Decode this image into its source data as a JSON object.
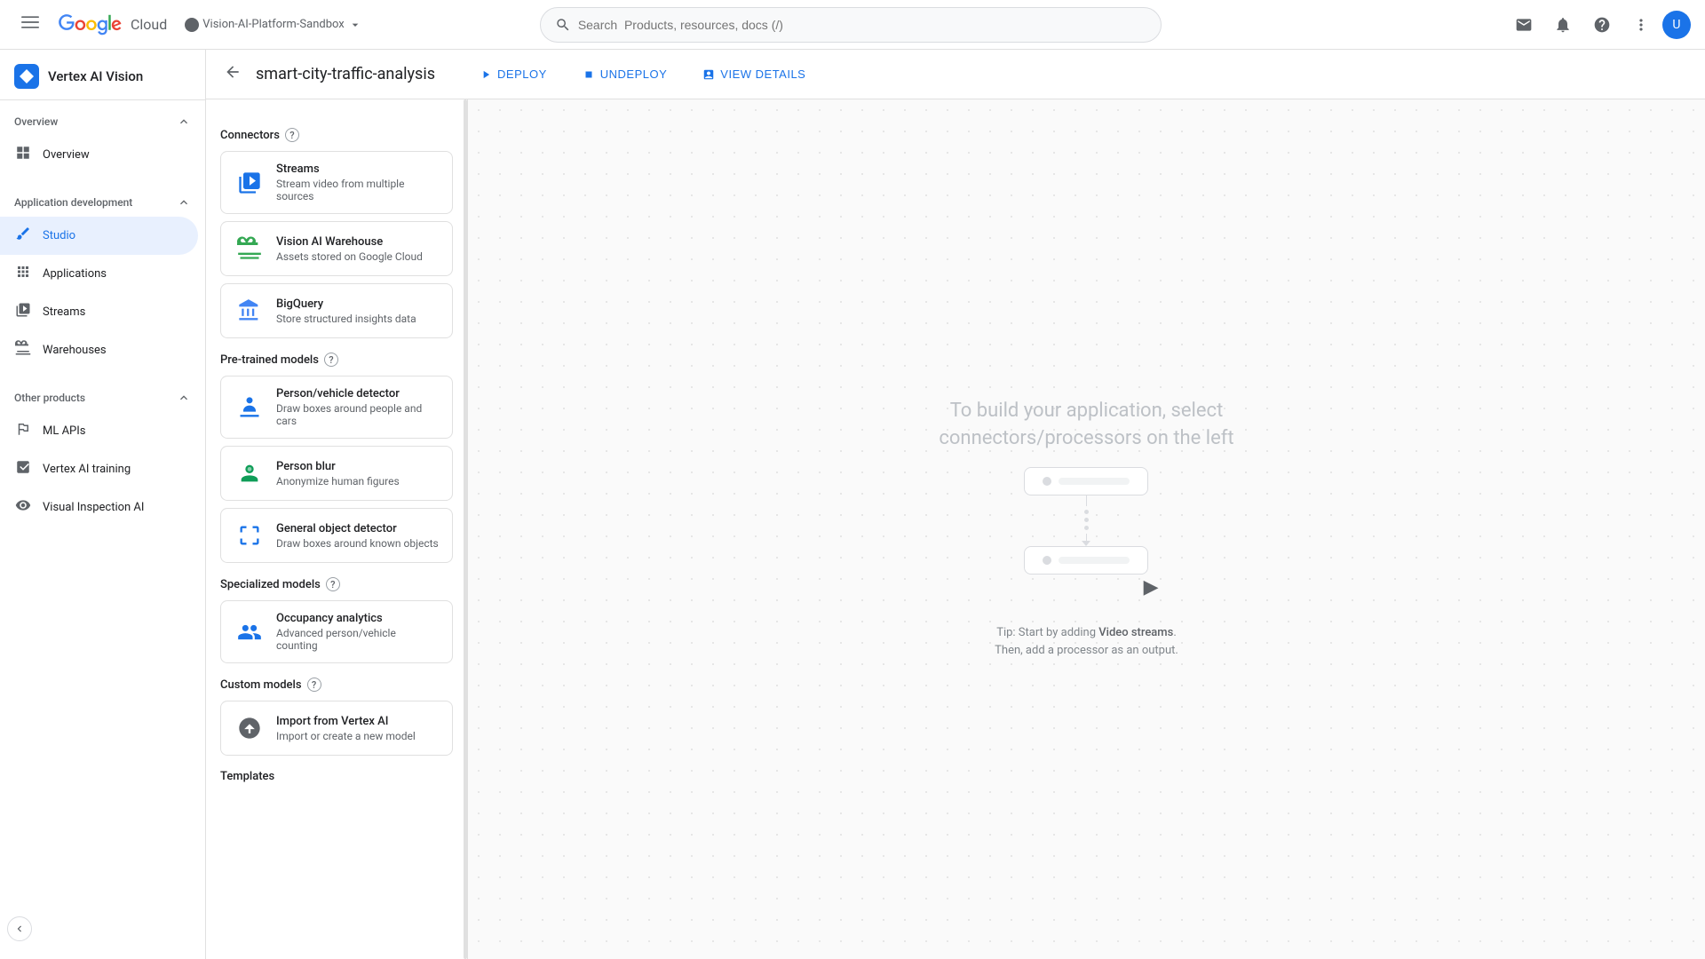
{
  "topbar": {
    "menu_label": "☰",
    "logo_text": "Google Cloud",
    "project_name": "Vision-AI-Platform-Sandbox",
    "search_placeholder": "Search  Products, resources, docs (/)",
    "search_icon": "🔍"
  },
  "sidebar": {
    "title": "Vertex AI Vision",
    "sections": [
      {
        "label": "Overview",
        "items": [
          {
            "id": "overview",
            "label": "Overview",
            "icon": "grid"
          }
        ]
      },
      {
        "label": "Application development",
        "items": [
          {
            "id": "studio",
            "label": "Studio",
            "icon": "brush",
            "active": true
          },
          {
            "id": "applications",
            "label": "Applications",
            "icon": "apps"
          },
          {
            "id": "streams",
            "label": "Streams",
            "icon": "stream"
          },
          {
            "id": "warehouses",
            "label": "Warehouses",
            "icon": "warehouse"
          }
        ]
      },
      {
        "label": "Other products",
        "items": [
          {
            "id": "ml-apis",
            "label": "ML APIs",
            "icon": "api"
          },
          {
            "id": "vertex-training",
            "label": "Vertex AI training",
            "icon": "model"
          },
          {
            "id": "visual-inspection",
            "label": "Visual Inspection AI",
            "icon": "inspect"
          }
        ]
      }
    ]
  },
  "subheader": {
    "title": "smart-city-traffic-analysis",
    "deploy_label": "DEPLOY",
    "undeploy_label": "UNDEPLOY",
    "view_details_label": "VIEW DETAILS"
  },
  "connectors_section": {
    "title": "Connectors",
    "items": [
      {
        "id": "streams",
        "title": "Streams",
        "description": "Stream video from multiple sources",
        "icon_type": "streams"
      },
      {
        "id": "vision-warehouse",
        "title": "Vision AI Warehouse",
        "description": "Assets stored on Google Cloud",
        "icon_type": "warehouse"
      },
      {
        "id": "bigquery",
        "title": "BigQuery",
        "description": "Store structured insights data",
        "icon_type": "bigquery"
      }
    ]
  },
  "pretrained_section": {
    "title": "Pre-trained models",
    "items": [
      {
        "id": "person-vehicle",
        "title": "Person/vehicle detector",
        "description": "Draw boxes around people and cars",
        "icon_type": "person"
      },
      {
        "id": "person-blur",
        "title": "Person blur",
        "description": "Anonymize human figures",
        "icon_type": "blur"
      },
      {
        "id": "general-object",
        "title": "General object detector",
        "description": "Draw boxes around known objects",
        "icon_type": "object"
      }
    ]
  },
  "specialized_section": {
    "title": "Specialized models",
    "items": [
      {
        "id": "occupancy",
        "title": "Occupancy analytics",
        "description": "Advanced person/vehicle counting",
        "icon_type": "occupancy"
      }
    ]
  },
  "custom_section": {
    "title": "Custom models",
    "items": [
      {
        "id": "import-vertex",
        "title": "Import from Vertex AI",
        "description": "Import or create a new model",
        "icon_type": "import"
      }
    ]
  },
  "templates_section": {
    "title": "Templates"
  },
  "canvas": {
    "placeholder_text": "To build your application, select\nconnectors/processors on the left",
    "tip_text": "Tip: Start by adding ",
    "tip_link": "Video streams",
    "tip_text2": ".\nThen, add a processor as an output."
  }
}
